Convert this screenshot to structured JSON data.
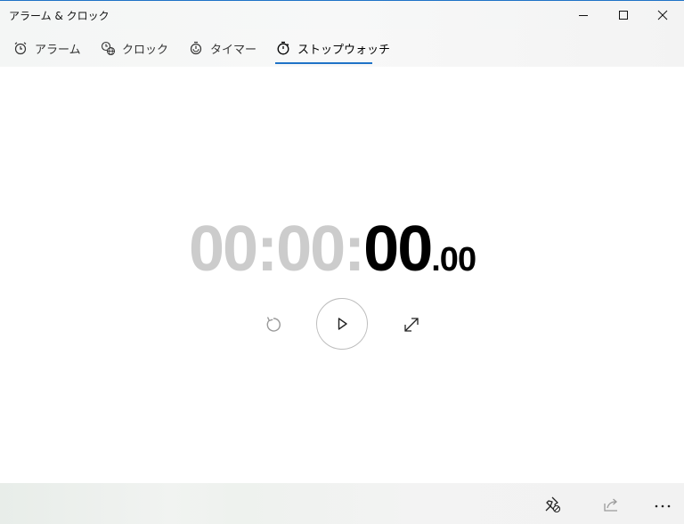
{
  "window": {
    "title": "アラーム & クロック",
    "accent_color": "#1f73c7"
  },
  "tabs": [
    {
      "label": "アラーム",
      "icon": "alarm-clock-icon"
    },
    {
      "label": "クロック",
      "icon": "world-clock-icon"
    },
    {
      "label": "タイマー",
      "icon": "timer-icon"
    },
    {
      "label": "ストップウォッチ",
      "icon": "stopwatch-icon",
      "selected": true
    }
  ],
  "stopwatch": {
    "hours": "00",
    "sep1": ":",
    "minutes": "00",
    "sep2": ":",
    "seconds": "00",
    "fraction": ".00"
  },
  "controls": {
    "reset_icon": "reset-icon",
    "play_icon": "play-icon",
    "expand_icon": "expand-icon"
  },
  "bottom": {
    "pin_icon": "pin-icon",
    "share_icon": "share-icon",
    "more_icon": "more-icon"
  }
}
